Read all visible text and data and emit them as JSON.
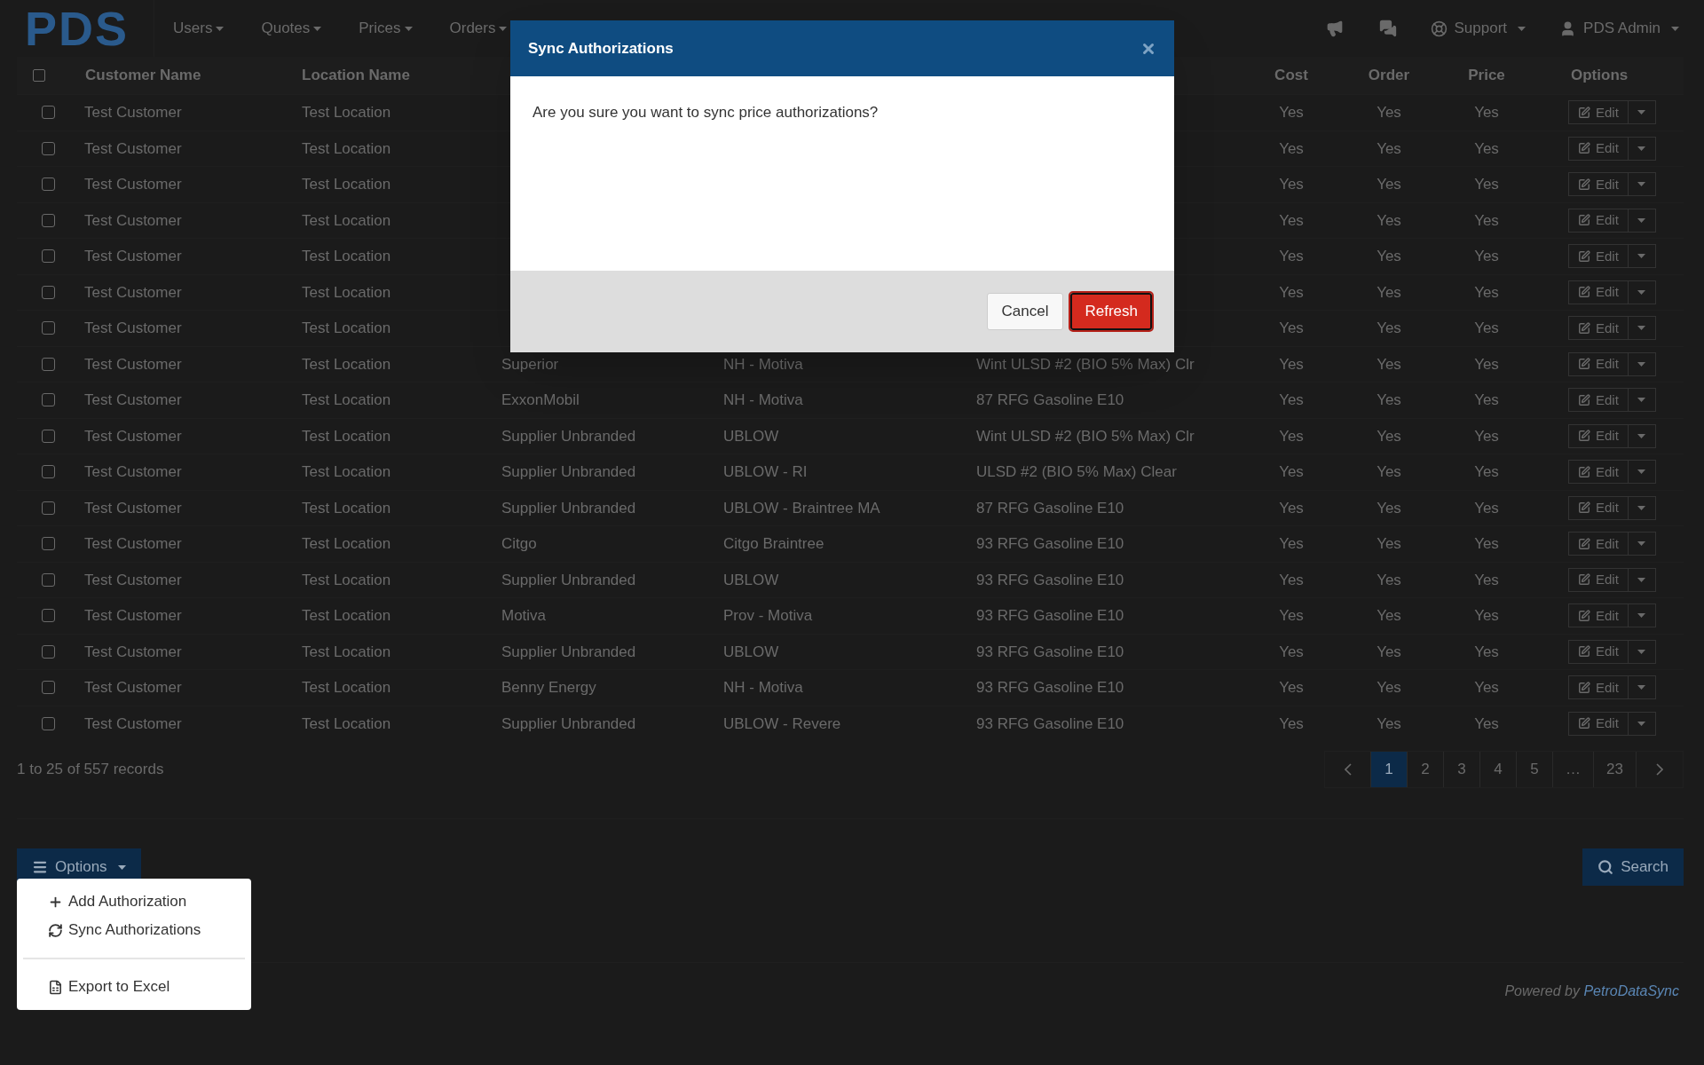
{
  "brand": {
    "logo": "PDS"
  },
  "nav": {
    "menus": [
      {
        "label": "Users"
      },
      {
        "label": "Quotes"
      },
      {
        "label": "Prices"
      },
      {
        "label": "Orders"
      }
    ],
    "support": "Support",
    "user": "PDS Admin"
  },
  "table": {
    "columns": [
      {
        "label": "Customer Name"
      },
      {
        "label": "Location Name"
      },
      {
        "label": "Cost"
      },
      {
        "label": "Order"
      },
      {
        "label": "Price"
      },
      {
        "label": "Options"
      }
    ],
    "header_checked": false,
    "rows": [
      {
        "checked": false,
        "customer": "Test Customer",
        "location": "Test Location",
        "cost": "Yes",
        "order": "Yes",
        "price": "Yes",
        "action": "Edit"
      },
      {
        "checked": false,
        "customer": "Test Customer",
        "location": "Test Location",
        "cost": "Yes",
        "order": "Yes",
        "price": "Yes",
        "action": "Edit"
      },
      {
        "checked": false,
        "customer": "Test Customer",
        "location": "Test Location",
        "cost": "Yes",
        "order": "Yes",
        "price": "Yes",
        "action": "Edit"
      },
      {
        "checked": false,
        "customer": "Test Customer",
        "location": "Test Location",
        "cost": "Yes",
        "order": "Yes",
        "price": "Yes",
        "action": "Edit"
      },
      {
        "checked": false,
        "customer": "Test Customer",
        "location": "Test Location",
        "cost": "Yes",
        "order": "Yes",
        "price": "Yes",
        "action": "Edit"
      },
      {
        "checked": false,
        "customer": "Test Customer",
        "location": "Test Location",
        "cost": "Yes",
        "order": "Yes",
        "price": "Yes",
        "action": "Edit"
      },
      {
        "checked": false,
        "customer": "Test Customer",
        "location": "Test Location",
        "cost": "Yes",
        "order": "Yes",
        "price": "Yes",
        "action": "Edit"
      },
      {
        "checked": false,
        "customer": "Test Customer",
        "location": "Test Location",
        "supplier": "Superior",
        "terminal": "NH - Motiva",
        "product": "Wint ULSD #2 (BIO 5% Max) Clr",
        "cost": "Yes",
        "order": "Yes",
        "price": "Yes",
        "action": "Edit"
      },
      {
        "checked": false,
        "customer": "Test Customer",
        "location": "Test Location",
        "supplier": "ExxonMobil",
        "terminal": "NH - Motiva",
        "product": "87 RFG Gasoline E10",
        "cost": "Yes",
        "order": "Yes",
        "price": "Yes",
        "action": "Edit"
      },
      {
        "checked": false,
        "customer": "Test Customer",
        "location": "Test Location",
        "supplier": "Supplier Unbranded",
        "terminal": "UBLOW",
        "product": "Wint ULSD #2 (BIO 5% Max) Clr",
        "cost": "Yes",
        "order": "Yes",
        "price": "Yes",
        "action": "Edit"
      },
      {
        "checked": false,
        "customer": "Test Customer",
        "location": "Test Location",
        "supplier": "Supplier Unbranded",
        "terminal": "UBLOW - RI",
        "product": "ULSD #2 (BIO 5% Max) Clear",
        "cost": "Yes",
        "order": "Yes",
        "price": "Yes",
        "action": "Edit"
      },
      {
        "checked": false,
        "customer": "Test Customer",
        "location": "Test Location",
        "supplier": "Supplier Unbranded",
        "terminal": "UBLOW - Braintree MA",
        "product": "87 RFG Gasoline E10",
        "cost": "Yes",
        "order": "Yes",
        "price": "Yes",
        "action": "Edit"
      },
      {
        "checked": false,
        "customer": "Test Customer",
        "location": "Test Location",
        "supplier": "Citgo",
        "terminal": "Citgo Braintree",
        "product": "93 RFG Gasoline E10",
        "cost": "Yes",
        "order": "Yes",
        "price": "Yes",
        "action": "Edit"
      },
      {
        "checked": false,
        "customer": "Test Customer",
        "location": "Test Location",
        "supplier": "Supplier Unbranded",
        "terminal": "UBLOW",
        "product": "93 RFG Gasoline E10",
        "cost": "Yes",
        "order": "Yes",
        "price": "Yes",
        "action": "Edit"
      },
      {
        "checked": false,
        "customer": "Test Customer",
        "location": "Test Location",
        "supplier": "Motiva",
        "terminal": "Prov - Motiva",
        "product": "93 RFG Gasoline E10",
        "cost": "Yes",
        "order": "Yes",
        "price": "Yes",
        "action": "Edit"
      },
      {
        "checked": false,
        "customer": "Test Customer",
        "location": "Test Location",
        "supplier": "Supplier Unbranded",
        "terminal": "UBLOW",
        "product": "93 RFG Gasoline E10",
        "cost": "Yes",
        "order": "Yes",
        "price": "Yes",
        "action": "Edit"
      },
      {
        "checked": false,
        "customer": "Test Customer",
        "location": "Test Location",
        "supplier": "Benny Energy",
        "terminal": "NH - Motiva",
        "product": "93 RFG Gasoline E10",
        "cost": "Yes",
        "order": "Yes",
        "price": "Yes",
        "action": "Edit"
      },
      {
        "checked": false,
        "customer": "Test Customer",
        "location": "Test Location",
        "supplier": "Supplier Unbranded",
        "terminal": "UBLOW - Revere",
        "product": "93 RFG Gasoline E10",
        "cost": "Yes",
        "order": "Yes",
        "price": "Yes",
        "action": "Edit"
      }
    ]
  },
  "records_info": "1 to 25 of 557 records",
  "pagination": {
    "pages": [
      {
        "label": "1",
        "selected": true
      },
      {
        "label": "2",
        "selected": false
      },
      {
        "label": "3",
        "selected": false
      },
      {
        "label": "4",
        "selected": false
      },
      {
        "label": "5",
        "selected": false
      },
      {
        "label": "…",
        "selected": false
      },
      {
        "label": "23",
        "selected": false
      }
    ]
  },
  "options_button": "Options",
  "options_menu": {
    "items": [
      {
        "kind": "add",
        "label": "Add Authorization"
      },
      {
        "kind": "sync",
        "label": "Sync Authorizations"
      },
      {
        "kind": "divider"
      },
      {
        "kind": "export",
        "label": "Export to Excel"
      }
    ]
  },
  "search_button": "Search",
  "footer": {
    "prefix": "Powered by",
    "link": "PetroDataSync"
  },
  "dialog": {
    "title": "Sync Authorizations",
    "message": "Are you sure you want to sync price authorizations?",
    "buttons": [
      {
        "kind": "cancel",
        "label": "Cancel"
      },
      {
        "kind": "primary",
        "label": "Refresh"
      }
    ]
  }
}
